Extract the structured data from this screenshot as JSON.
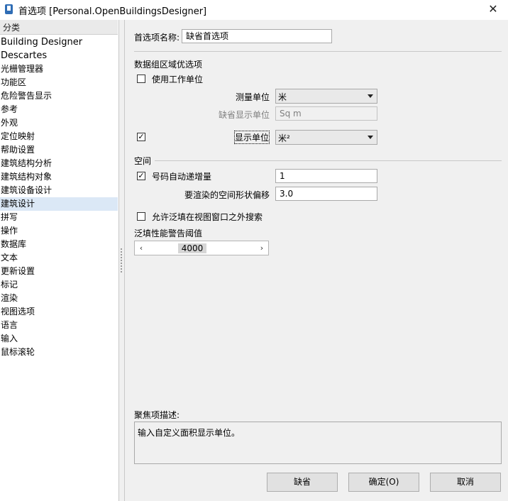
{
  "window": {
    "title": "首选项 [Personal.OpenBuildingsDesigner]",
    "close_glyph": "✕"
  },
  "categories": {
    "header": "分类",
    "items": [
      "Building Designer",
      "Descartes",
      "光栅管理器",
      "功能区",
      "危险警告显示",
      "参考",
      "外观",
      "定位映射",
      "帮助设置",
      "建筑结构分析",
      "建筑结构对象",
      "建筑设备设计",
      "建筑设计",
      "拼写",
      "操作",
      "数据库",
      "文本",
      "更新设置",
      "标记",
      "渲染",
      "视图选项",
      "语言",
      "输入",
      "鼠标滚轮"
    ],
    "selected_index": 12
  },
  "form": {
    "pref_name_label": "首选项名称:",
    "pref_name_value": "缺省首选项",
    "data_section_label": "数据组区域优选项",
    "use_working_units_label": "使用工作单位",
    "use_working_units_checked": false,
    "measure_unit_label": "测量单位",
    "measure_unit_value": "米",
    "default_display_unit_label": "缺省显示单位",
    "default_display_unit_value": "Sq m",
    "display_unit_checked": true,
    "display_unit_label": "显示单位",
    "display_unit_value": "米²",
    "space_section_label": "空间",
    "auto_increment_label": "号码自动递增量",
    "auto_increment_checked": true,
    "auto_increment_value": "1",
    "shape_offset_label": "要渲染的空间形状偏移",
    "shape_offset_value": "3.0",
    "flood_search_label": "允许泛填在视图窗口之外搜索",
    "flood_search_checked": false,
    "flood_threshold_label": "泛填性能警告阈值",
    "flood_threshold_value": "4000",
    "check_glyph": "✓",
    "left_arrow_glyph": "‹",
    "right_arrow_glyph": "›"
  },
  "focus": {
    "label": "聚焦项描述:",
    "text": "输入自定义面积显示单位。"
  },
  "buttons": {
    "default": "缺省",
    "ok": "确定(O)",
    "cancel": "取消"
  },
  "colors": {
    "selected_item_bg": "#dbe8f6",
    "panel_bg": "#f0f0f0",
    "button_bg": "#e1e1e1"
  }
}
